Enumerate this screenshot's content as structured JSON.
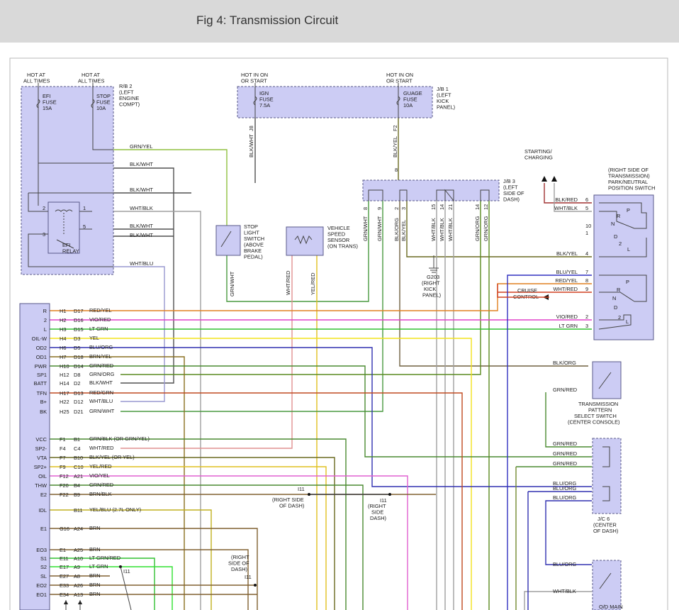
{
  "header": {
    "title": "Fig 4: Transmission Circuit"
  },
  "top_labels": {
    "hot_all_1": [
      "HOT AT",
      "ALL TIMES"
    ],
    "hot_all_2": [
      "HOT AT",
      "ALL TIMES"
    ],
    "hot_on_1": [
      "HOT IN ON",
      "OR START"
    ],
    "hot_on_2": [
      "HOT IN ON",
      "OR START"
    ],
    "starting_charging": [
      "STARTING/",
      "CHARGING"
    ]
  },
  "components": {
    "rb2": [
      "R/B 2",
      "(LEFT",
      "ENGINE",
      "COMPT)"
    ],
    "efi_fuse": [
      "EFI",
      "FUSE",
      "15A"
    ],
    "stop_fuse": [
      "STOP",
      "FUSE",
      "10A"
    ],
    "efi_relay": [
      "EFI",
      "RELAY"
    ],
    "jb1": [
      "J/B 1",
      "(LEFT",
      "KICK",
      "PANEL)"
    ],
    "ign_fuse": [
      "IGN",
      "FUSE",
      "7.5A"
    ],
    "gauge_fuse": [
      "GUAGE",
      "FUSE",
      "10A"
    ],
    "jb3": [
      "J/B 3",
      "(LEFT",
      "SIDE OF",
      "DASH)"
    ],
    "stop_light_switch": [
      "STOP",
      "LIGHT",
      "SWITCH",
      "(ABOVE",
      "BRAKE",
      "PEDAL)"
    ],
    "vehicle_speed_sensor": [
      "VEHICLE",
      "SPEED",
      "SENSOR",
      "(ON TRANS)"
    ],
    "g203": [
      "G203",
      "(RIGHT",
      "KICK",
      "PANEL)"
    ],
    "park_neutral": [
      "(RIGHT SIDE OF",
      "TRANSMISSION)",
      "PARK/NEUTRAL",
      "POSITION SWITCH"
    ],
    "cruise_control": [
      "CRUISE",
      "CONTROL"
    ],
    "pattern_switch": [
      "TRANSMISSION",
      "PATTERN",
      "SELECT SWITCH",
      "(CENTER CONSOLE)"
    ],
    "jc6": [
      "J/C 6",
      "(CENTER",
      "OF DASH)"
    ],
    "od_main": "O/D MAIN",
    "i11_a": [
      "(RIGHT SIDE",
      "OF DASH)"
    ],
    "i11_b": [
      "(RIGHT",
      "SIDE",
      "DASH)"
    ],
    "i11_c": [
      "(RIGHT",
      "SIDE OF",
      "DASH)"
    ],
    "i11": "I11"
  },
  "upper_wires": {
    "grn_yel": "GRN/YEL",
    "blk_wht_1": "BLK/WHT",
    "blk_wht_2": "BLK/WHT",
    "wht_blk": "WHT/BLK",
    "blk_wht_3": "BLK/WHT",
    "blk_wht_4": "BLK/WHT",
    "wht_blu": "WHT/BLU",
    "blk_wht_v": "BLK/WHT",
    "blk_yel_v": "BLK/YEL",
    "ign_pin": "J8",
    "gauge_pin": "F2",
    "relay_pins": [
      "2",
      "1",
      "3",
      "5"
    ],
    "jb3_top_pin": "8",
    "jb3_wires": [
      {
        "pin": "8",
        "color": "GRN/WHT"
      },
      {
        "pin": "9",
        "color": "GRN/WHT"
      },
      {
        "pin": "2",
        "color": "BLK/ORG"
      },
      {
        "pin": "3",
        "color": "BLK/YEL"
      },
      {
        "pin": "15",
        "color": "WHT/BLK"
      },
      {
        "pin": "14",
        "color": "WHT/BLK"
      },
      {
        "pin": "21",
        "color": "WHT/BLK"
      },
      {
        "pin": "14",
        "color": "GRN/ORG"
      },
      {
        "pin": "12",
        "color": "GRN/ORG"
      }
    ],
    "stop_sw_out": "GRN/WHT",
    "vss_out_1": "WHT/RED",
    "vss_out_2": "YEL/RED"
  },
  "ecm_rows": [
    {
      "name": "R",
      "p1": "H1",
      "p2": "D17",
      "wire": "RED/YEL"
    },
    {
      "name": "2",
      "p1": "H2",
      "p2": "D16",
      "wire": "VIO/RED"
    },
    {
      "name": "L",
      "p1": "H3",
      "p2": "D15",
      "wire": "LT GRN"
    },
    {
      "name": "OIL-W",
      "p1": "H4",
      "p2": "D3",
      "wire": "YEL"
    },
    {
      "name": "OD2",
      "p1": "H6",
      "p2": "D5",
      "wire": "BLU/ORG"
    },
    {
      "name": "OD1",
      "p1": "H7",
      "p2": "D18",
      "wire": "BRN/YEL"
    },
    {
      "name": "PWR",
      "p1": "H10",
      "p2": "D14",
      "wire": "GRN/RED"
    },
    {
      "name": "SP1",
      "p1": "H12",
      "p2": "D8",
      "wire": "GRN/ORG"
    },
    {
      "name": "BATT",
      "p1": "H14",
      "p2": "D2",
      "wire": "BLK/WHT"
    },
    {
      "name": "TFN",
      "p1": "H17",
      "p2": "D13",
      "wire": "RED/GRN"
    },
    {
      "name": "B+",
      "p1": "H22",
      "p2": "D12",
      "wire": "WHT/BLU"
    },
    {
      "name": "BK",
      "p1": "H25",
      "p2": "D21",
      "wire": "GRN/WHT"
    },
    {
      "name": "VCC",
      "p1": "F1",
      "p2": "B1",
      "wire": "GRN/BLK (OR GRN/YEL)"
    },
    {
      "name": "SP2-",
      "p1": "F4",
      "p2": "C4",
      "wire": "WHT/RED"
    },
    {
      "name": "VTA",
      "p1": "F7",
      "p2": "B10",
      "wire": "BLK/YEL (OR YEL)"
    },
    {
      "name": "SP2+",
      "p1": "F9",
      "p2": "C10",
      "wire": "YEL/RED"
    },
    {
      "name": "OIL",
      "p1": "F12",
      "p2": "A21",
      "wire": "VIO/YEL"
    },
    {
      "name": "THW",
      "p1": "F20",
      "p2": "B4",
      "wire": "GRN/RED"
    },
    {
      "name": "E2",
      "p1": "F22",
      "p2": "B9",
      "wire": "BRN/BLK"
    },
    {
      "name": "IDL",
      "p1": "",
      "p2": "B11",
      "wire": "YEL/BLU     (2.7L ONLY)"
    },
    {
      "name": "E1",
      "p1": "G16",
      "p2": "A24",
      "wire": "BRN"
    },
    {
      "name": "EO3",
      "p1": "E1",
      "p2": "A25",
      "wire": "BRN"
    },
    {
      "name": "S1",
      "p1": "E11",
      "p2": "A10",
      "wire": "LT GRN/RED"
    },
    {
      "name": "S2",
      "p1": "E17",
      "p2": "A9",
      "wire": "LT GRN"
    },
    {
      "name": "SL",
      "p1": "E27",
      "p2": "A8",
      "wire": "BRN"
    },
    {
      "name": "EO2",
      "p1": "E33",
      "p2": "A26",
      "wire": "BRN"
    },
    {
      "name": "EO1",
      "p1": "E34",
      "p2": "A13",
      "wire": "BRN"
    }
  ],
  "right_wires": [
    {
      "label": "BLK/RED",
      "pin": "6"
    },
    {
      "label": "WHT/BLK",
      "pin": "5"
    },
    {
      "label": "",
      "pin": "10"
    },
    {
      "label": "",
      "pin": "1"
    },
    {
      "label": "BLK/YEL",
      "pin": "4"
    },
    {
      "label": "BLU/YEL",
      "pin": "7"
    },
    {
      "label": "RED/YEL",
      "pin": "8"
    },
    {
      "label": "WHT/RED",
      "pin": "9"
    },
    {
      "label": "VIO/RED",
      "pin": "2"
    },
    {
      "label": "LT GRN",
      "pin": "3"
    }
  ],
  "pn_switch_letters": {
    "upper": [
      "P",
      "R",
      "N",
      "D",
      "2",
      "L"
    ],
    "lower": [
      "P",
      "R",
      "N",
      "D",
      "2",
      "L"
    ]
  },
  "pattern_wires": {
    "blk_org": "BLK/ORG",
    "grn_red": "GRN/RED"
  },
  "jc6_wires": [
    "GRN/RED",
    "GRN/RED",
    "GRN/RED",
    "BLU/ORG",
    "BLU/ORG",
    "BLU/ORG"
  ],
  "od_wires": {
    "blu_org": "BLU/ORG",
    "wht_blk": "WHT/BLK"
  },
  "colors": {
    "red_yel": "#e08020",
    "vio_red": "#e040c8",
    "lt_grn": "#30c030",
    "yel": "#f2e21a",
    "blu_org": "#3030b0",
    "brn_yel": "#8a7020",
    "grn_red": "#4a8a30",
    "grn_org": "#5a8a20",
    "blk_wht": "#505050",
    "red_grn": "#c04a20",
    "wht_blu": "#9898d0",
    "grn_wht": "#4a9a40",
    "grn_yel": "#90c040",
    "wht_red": "#e09090",
    "yel_red": "#e0c020",
    "vio_yel": "#e060d0",
    "brn": "#806030",
    "lt_grn_bright": "#30e030",
    "blk_red": "#a03030",
    "wht_blk": "#a0a0a0",
    "blk_org": "#706040",
    "blk_yel": "#6a6a20",
    "blu_yel": "#3030c0",
    "red_yel_dk": "#d04020"
  }
}
